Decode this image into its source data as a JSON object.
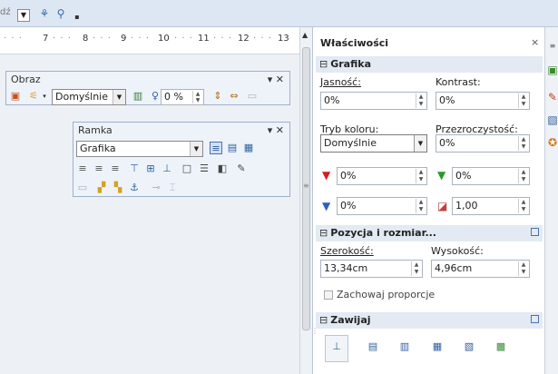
{
  "toolbar": {
    "fragment": "dź",
    "dropdown_arrow": "▼",
    "icon1": "⚘",
    "icon2": "⚲",
    "small": "▪"
  },
  "ruler": {
    "ticks": [
      "7",
      "8",
      "9",
      "10",
      "11",
      "12",
      "13"
    ],
    "dots": "· · ·"
  },
  "obraz": {
    "title": "Obraz",
    "controls": "▾ ✕",
    "mode_value": "Domyślnie",
    "transparency_value": "0 %"
  },
  "ramka": {
    "title": "Ramka",
    "controls": "▾ ✕",
    "style_value": "Grafika"
  },
  "panel": {
    "title": "Właściwości",
    "close": "×",
    "grafika": {
      "header": "Grafika",
      "brightness_label": "Jasność:",
      "contrast_label": "Kontrast:",
      "brightness_value": "0%",
      "contrast_value": "0%",
      "color_mode_label": "Tryb koloru:",
      "transparency_label": "Przezroczystość:",
      "color_mode_value": "Domyślnie",
      "transparency_value": "0%",
      "red_value": "0%",
      "green_value": "0%",
      "blue_value": "0%",
      "gamma_value": "1,00"
    },
    "pozycja": {
      "header": "Pozycja i rozmiar...",
      "width_label": "Szerokość:",
      "height_label": "Wysokość:",
      "width_value": "13,34cm",
      "height_value": "4,96cm",
      "keep_ratio_label": "Zachowaj proporcje"
    },
    "zawijaj": {
      "header": "Zawijaj"
    }
  },
  "colors": {
    "accent": "#4a72b0",
    "section_bg": "#e3eaf3",
    "toolbar_bg": "#dde7f3"
  }
}
